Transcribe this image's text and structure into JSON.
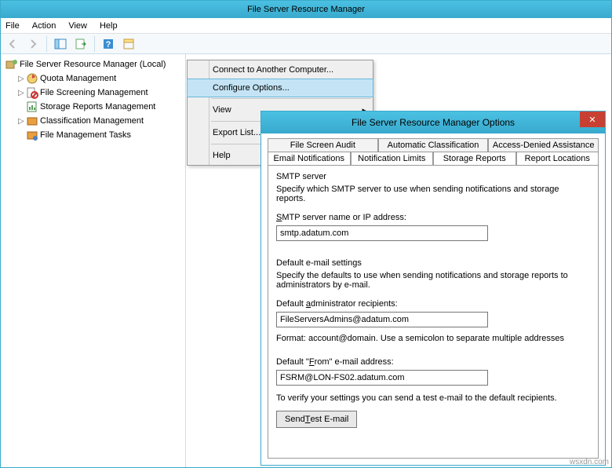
{
  "window": {
    "title": "File Server Resource Manager"
  },
  "menubar": {
    "file": "File",
    "action": "Action",
    "view": "View",
    "help": "Help"
  },
  "tree": {
    "root": "File Server Resource Manager (Local)",
    "quota": "Quota Management",
    "filescr": "File Screening Management",
    "storage": "Storage Reports Management",
    "classif": "Classification Management",
    "tasks": "File Management Tasks"
  },
  "ctx": {
    "connect": "Connect to Another Computer...",
    "configure": "Configure Options...",
    "view": "View",
    "export": "Export List...",
    "help": "Help"
  },
  "dlg": {
    "title": "File Server Resource Manager Options",
    "tabs_back": {
      "fsa": "File Screen Audit",
      "ac": "Automatic Classification",
      "ada": "Access-Denied Assistance"
    },
    "tabs_front": {
      "email": "Email Notifications",
      "nl": "Notification Limits",
      "sr": "Storage Reports",
      "rl": "Report Locations"
    },
    "smtp_hdr": "SMTP server",
    "smtp_desc": "Specify which SMTP server to use when sending notifications and storage reports.",
    "smtp_lbl": "SMTP server name or IP address:",
    "smtp_val": "smtp.adatum.com",
    "def_hdr": "Default e-mail settings",
    "def_desc": "Specify the defaults to use when sending notifications and storage reports to administrators by e-mail.",
    "admin_lbl": "Default administrator recipients:",
    "admin_val": "FileServersAdmins@adatum.com",
    "format": "Format: account@domain. Use a semicolon to separate multiple addresses",
    "from_lbl": "Default \"From\" e-mail address:",
    "from_val": "FSRM@LON-FS02.adatum.com",
    "verify": "To verify your settings you can send a test e-mail to the default recipients.",
    "send": "Send Test E-mail"
  },
  "watermark": "wsxdn.com"
}
